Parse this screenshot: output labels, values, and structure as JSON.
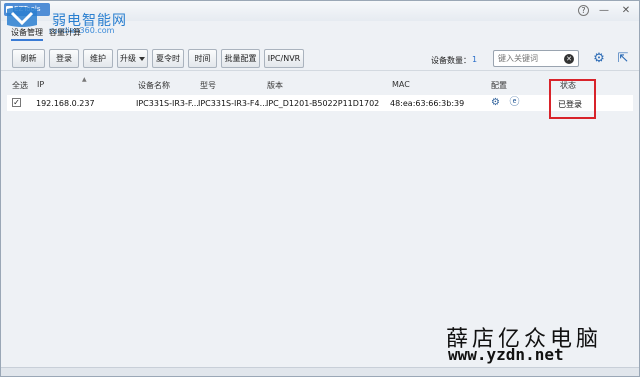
{
  "title": {
    "app_label": "EZTools"
  },
  "logo": {
    "name_cn": "弱电智能网",
    "url": "ruodian360.com"
  },
  "window_controls": {
    "help": "?",
    "minimize": "—",
    "close": "✕"
  },
  "menu": {
    "items": [
      "设备管理",
      "容量计算"
    ]
  },
  "toolbar": {
    "buttons": [
      "刷新",
      "登录",
      "维护",
      "升级",
      "夏令时",
      "时间",
      "批量配置",
      "IPC/NVR"
    ],
    "device_count_label": "设备数量：",
    "device_count_value": "1"
  },
  "search": {
    "placeholder": "键入关键词"
  },
  "table": {
    "headers": [
      "全选",
      "IP",
      "设备名称",
      "型号",
      "版本",
      "MAC",
      "配置",
      "状态"
    ],
    "rows": [
      {
        "checked": "✓",
        "ip": "192.168.0.237",
        "device_name": "IPC331S-IR3-F...",
        "model": "IPC331S-IR3-F4...",
        "version": "IPC_D1201-B5022P11D1702",
        "mac": "48:ea:63:66:3b:39",
        "status": "已登录"
      }
    ]
  },
  "watermark": {
    "name_cn": "薛店亿众电脑",
    "url": "www.yzdn.net"
  },
  "colors": {
    "accent": "#2c6bb5",
    "highlight": "#d8232a"
  }
}
